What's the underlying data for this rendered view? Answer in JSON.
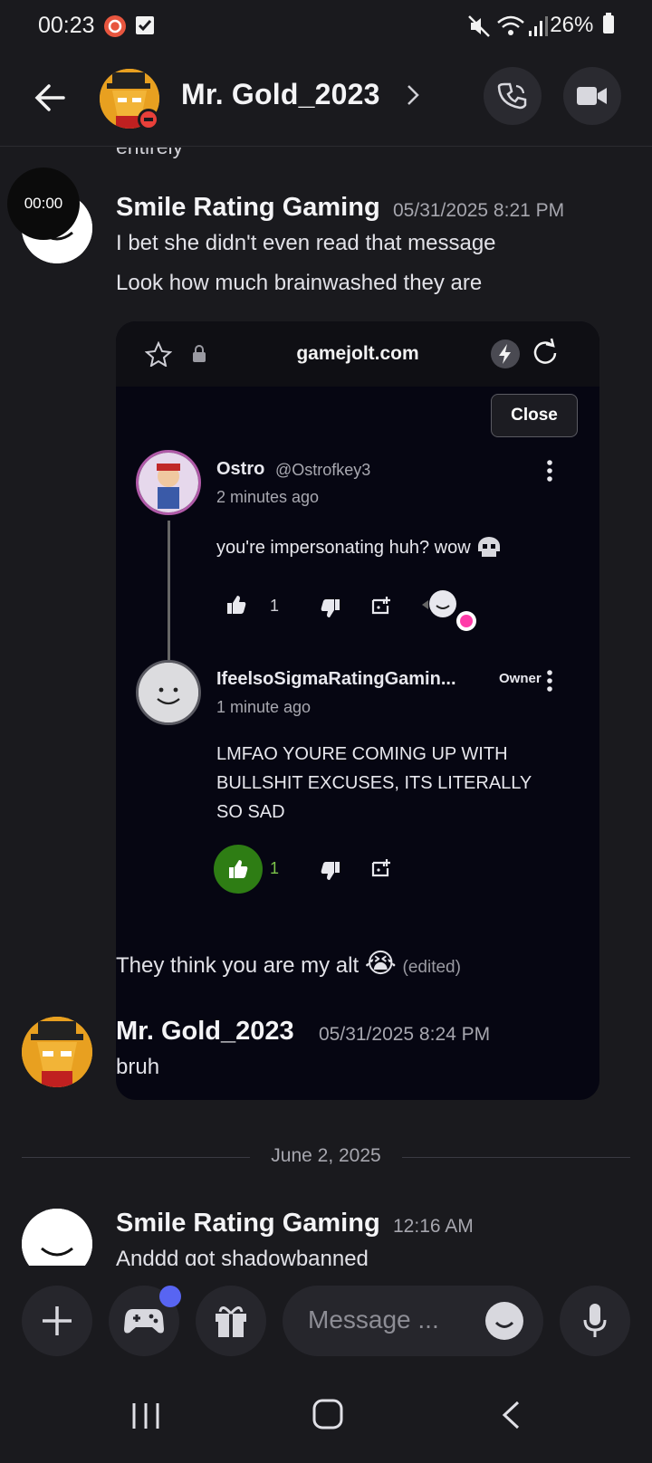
{
  "status_bar": {
    "time": "00:23",
    "battery": "26%"
  },
  "header": {
    "title": "Mr. Gold_2023"
  },
  "chat": {
    "cut_off_text": "entirely",
    "timer": "00:00",
    "messages": [
      {
        "author": "Smile Rating Gaming",
        "timestamp": "05/31/2025 8:21 PM",
        "lines": [
          "I bet she didn't even read that message",
          "Look how much brainwashed they are"
        ],
        "embed": {
          "domain": "gamejolt.com",
          "close_label": "Close",
          "comments": [
            {
              "name": "Ostro",
              "handle": "@Ostrofkey3",
              "time": "2 minutes ago",
              "text": "you're impersonating huh? wow",
              "likes": "1"
            },
            {
              "name": "IfeelsoSigmaRatingGamin...",
              "owner_label": "Owner",
              "time": "1 minute ago",
              "text_lines": [
                "LMFAO YOURE COMING UP WITH",
                "BULLSHIT EXCUSES, ITS LITERALLY",
                "SO SAD"
              ],
              "likes": "1"
            }
          ]
        },
        "after_embed": "They think you are my alt",
        "after_embed_emoji": "😭",
        "edited": "(edited)"
      },
      {
        "author": "Mr. Gold_2023",
        "timestamp": "05/31/2025 8:24 PM",
        "lines": [
          "bruh"
        ]
      },
      {
        "author": "Smile Rating Gaming",
        "timestamp": "12:16 AM",
        "lines": [
          "Anddd got shadowbanned"
        ]
      }
    ],
    "date_divider": "June 2, 2025"
  },
  "composer": {
    "placeholder": "Message ..."
  },
  "colors": {
    "background": "#1a1a1e",
    "accent": "#5865f2",
    "like_green": "#2e7d14",
    "notif_badge": "#e8563f"
  }
}
